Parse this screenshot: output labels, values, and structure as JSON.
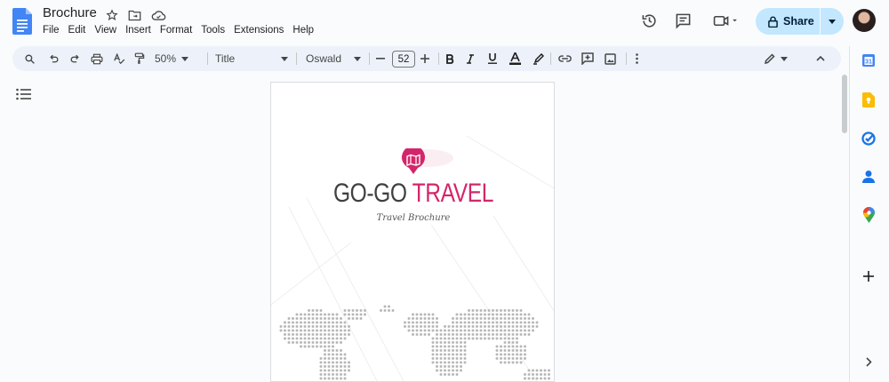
{
  "app": {
    "doc_title": "Brochure"
  },
  "menu": [
    "File",
    "Edit",
    "View",
    "Insert",
    "Format",
    "Tools",
    "Extensions",
    "Help"
  ],
  "header": {
    "share_label": "Share"
  },
  "toolbar": {
    "zoom": "50%",
    "style": "Title",
    "font": "Oswald",
    "font_size": "52"
  },
  "document": {
    "title_part1": "GO-GO ",
    "title_part2": "TRAVEL",
    "subtitle": "Travel Brochure"
  },
  "colors": {
    "accent": "#d3266a",
    "share_bg": "#c2e7ff",
    "toolbar_bg": "#edf2fa",
    "doc_icon": "#4285f4"
  }
}
